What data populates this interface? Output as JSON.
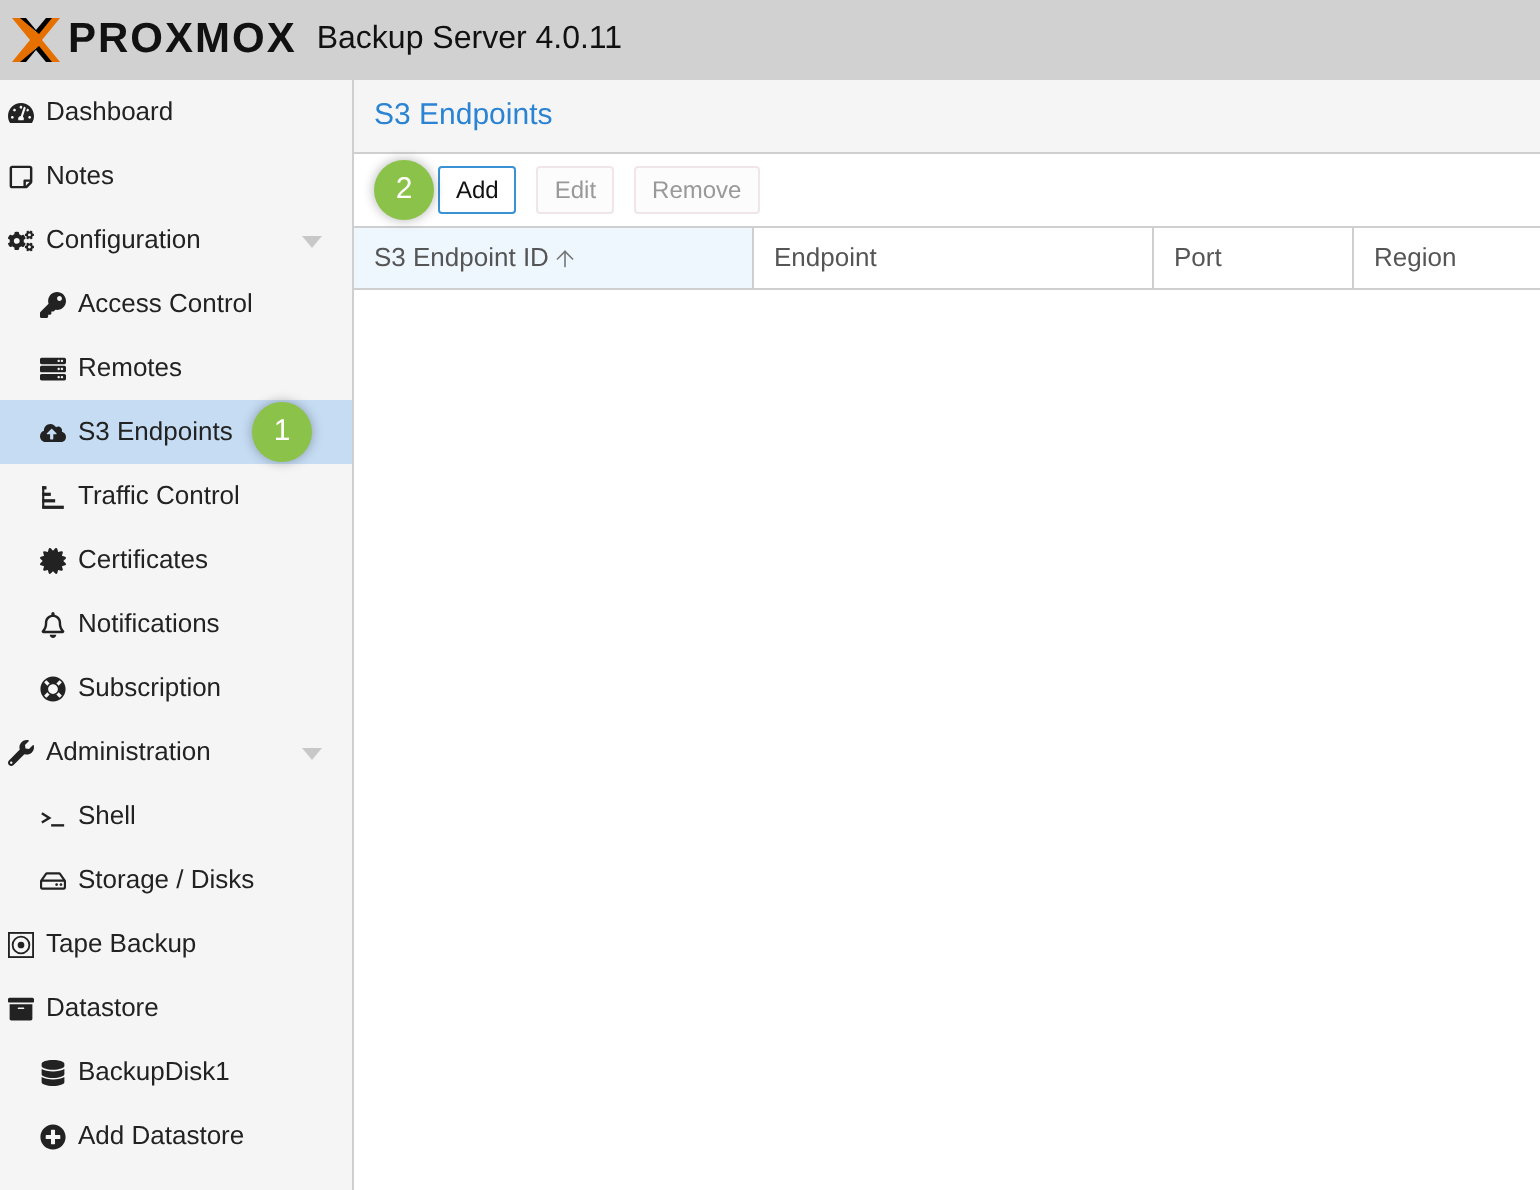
{
  "header": {
    "logo": "PROXMOX",
    "product": "Backup Server 4.0.11"
  },
  "sidebar": {
    "items": [
      {
        "label": "Dashboard",
        "selected": false
      },
      {
        "label": "Notes",
        "selected": false
      },
      {
        "label": "Configuration",
        "selected": false,
        "expanded": true,
        "children": [
          {
            "label": "Access Control",
            "selected": false
          },
          {
            "label": "Remotes",
            "selected": false
          },
          {
            "label": "S3 Endpoints",
            "selected": true,
            "callout": "1"
          },
          {
            "label": "Traffic Control",
            "selected": false
          },
          {
            "label": "Certificates",
            "selected": false
          },
          {
            "label": "Notifications",
            "selected": false
          },
          {
            "label": "Subscription",
            "selected": false
          }
        ]
      },
      {
        "label": "Administration",
        "selected": false,
        "expanded": true,
        "children": [
          {
            "label": "Shell",
            "selected": false
          },
          {
            "label": "Storage / Disks",
            "selected": false
          }
        ]
      },
      {
        "label": "Tape Backup",
        "selected": false
      },
      {
        "label": "Datastore",
        "selected": false,
        "children": [
          {
            "label": "BackupDisk1",
            "selected": false
          },
          {
            "label": "Add Datastore",
            "selected": false
          }
        ]
      }
    ]
  },
  "panel": {
    "title": "S3 Endpoints",
    "toolbar": [
      {
        "label": "Add",
        "disabled": false,
        "callout": "2"
      },
      {
        "label": "Edit",
        "disabled": true
      },
      {
        "label": "Remove",
        "disabled": true
      }
    ],
    "columns": [
      {
        "label": "S3 Endpoint ID",
        "sorted": true
      },
      {
        "label": "Endpoint",
        "sorted": false
      },
      {
        "label": "Port",
        "sorted": false
      },
      {
        "label": "Region",
        "sorted": false
      }
    ]
  }
}
